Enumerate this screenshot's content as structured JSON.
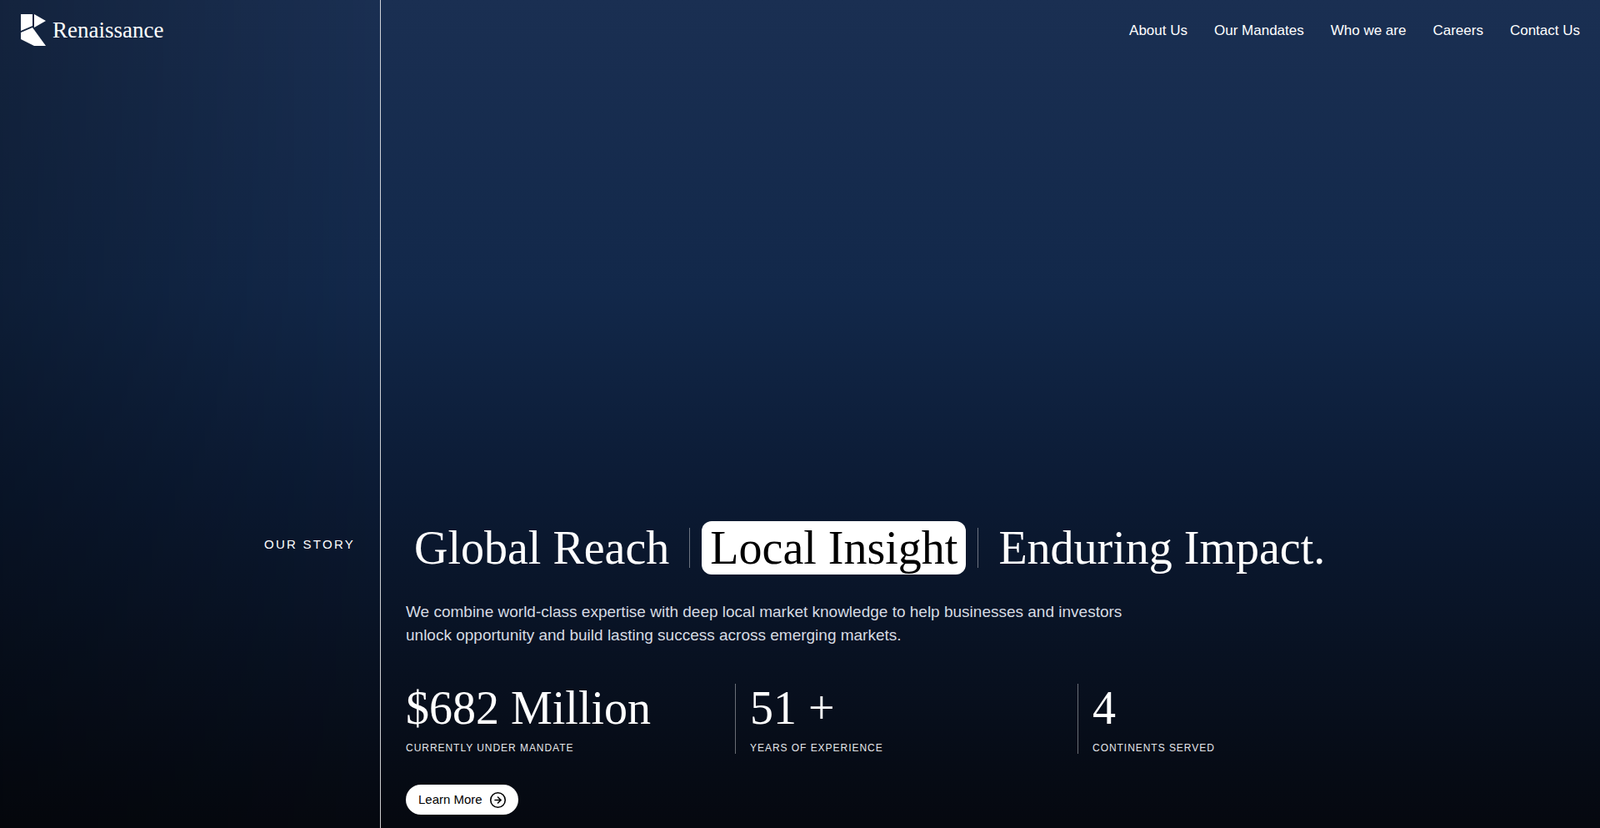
{
  "logo": {
    "text": "Renaissance"
  },
  "nav": {
    "items": [
      {
        "label": "About Us"
      },
      {
        "label": "Our Mandates"
      },
      {
        "label": "Who we are"
      },
      {
        "label": "Careers"
      },
      {
        "label": "Contact Us"
      }
    ]
  },
  "hero": {
    "section_label": "OUR STORY",
    "headlines": [
      {
        "label": "Global Reach",
        "selected": false
      },
      {
        "label": "Local Insight",
        "selected": true
      },
      {
        "label": "Enduring Impact.",
        "selected": false
      }
    ],
    "paragraph": "We combine world-class expertise with deep local market knowledge to help businesses and investors unlock opportunity and build lasting success across emerging markets.",
    "stats": [
      {
        "value": "$682 Million",
        "label": "CURRENTLY UNDER MANDATE"
      },
      {
        "value": "51 +",
        "label": "YEARS OF EXPERIENCE"
      },
      {
        "value": "4",
        "label": "CONTINENTS SERVED"
      }
    ],
    "button": {
      "label": "Learn More"
    }
  }
}
